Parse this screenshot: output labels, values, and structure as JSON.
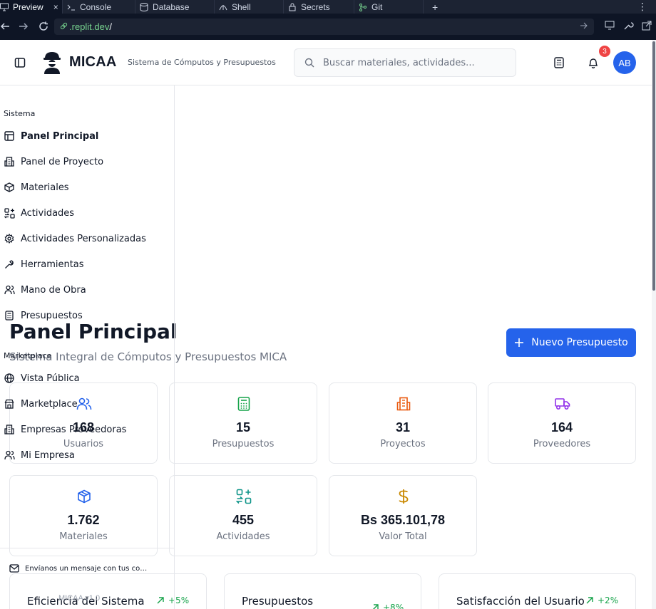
{
  "browser": {
    "tabs": [
      {
        "label": "Preview",
        "icon": "monitor-icon",
        "active": true
      },
      {
        "label": "Console",
        "icon": "terminal-icon"
      },
      {
        "label": "Database",
        "icon": "database-icon"
      },
      {
        "label": "Shell",
        "icon": "shell-icon"
      },
      {
        "label": "Secrets",
        "icon": "lock-icon"
      },
      {
        "label": "Git",
        "icon": "git-icon"
      }
    ],
    "close_glyph": "×",
    "plus_glyph": "+",
    "more_glyph": "⋮",
    "url_host": ".replit.dev",
    "url_path": "/"
  },
  "header": {
    "brand": "MICAA",
    "subtitle": "Sistema de Cómputos y Presupuestos",
    "search_placeholder": "Buscar materiales, actividades...",
    "notification_count": "3",
    "avatar_initials": "AB"
  },
  "sidebar": {
    "section_system": "Sistema",
    "items_system": [
      {
        "label": "Panel Principal",
        "icon": "layout-icon"
      },
      {
        "label": "Panel de Proyecto",
        "icon": "building-icon"
      },
      {
        "label": "Materiales",
        "icon": "package-icon"
      },
      {
        "label": "Actividades",
        "icon": "activity-grid-icon"
      },
      {
        "label": "Actividades Personalizadas",
        "icon": "settings-icon"
      },
      {
        "label": "Herramientas",
        "icon": "wrench-icon"
      },
      {
        "label": "Mano de Obra",
        "icon": "users-icon"
      },
      {
        "label": "Presupuestos",
        "icon": "calculator-icon"
      }
    ],
    "section_marketplace": "Marketplace",
    "items_marketplace": [
      {
        "label": "Vista Pública",
        "icon": "globe-icon"
      },
      {
        "label": "Marketplace",
        "icon": "store-icon"
      },
      {
        "label": "Empresas Proveedoras",
        "icon": "building-icon"
      },
      {
        "label": "Mi Empresa",
        "icon": "user-icon"
      }
    ],
    "footer_message": "Envíanos un mensaje con tus co…",
    "footer_version": "MICAA v1.0"
  },
  "main": {
    "title": "Panel Principal",
    "subtitle": "Sistema Integral de Cómputos y Presupuestos MICA",
    "new_button_label": "Nuevo Presupuesto",
    "stats": [
      {
        "value": "168",
        "label": "Usuarios",
        "icon": "users-icon",
        "color": "#2563eb"
      },
      {
        "value": "15",
        "label": "Presupuestos",
        "icon": "calculator-icon",
        "color": "#16a34a"
      },
      {
        "value": "31",
        "label": "Proyectos",
        "icon": "building-icon",
        "color": "#ea580c"
      },
      {
        "value": "164",
        "label": "Proveedores",
        "icon": "truck-icon",
        "color": "#9333ea"
      },
      {
        "value": "1.762",
        "label": "Materiales",
        "icon": "package-icon",
        "color": "#2563eb"
      },
      {
        "value": "455",
        "label": "Actividades",
        "icon": "activity-grid-icon",
        "color": "#0d9488"
      },
      {
        "value": "Bs 365.101,78",
        "label": "Valor Total",
        "icon": "dollar-icon",
        "color": "#ca8a04"
      }
    ],
    "bottom_cards": [
      {
        "title": "Eficiencia del Sistema",
        "trend": "+5%"
      },
      {
        "title": "Presupuestos",
        "trend": "+8%"
      },
      {
        "title": "Satisfacción del Usuario",
        "trend": "+2%"
      }
    ]
  }
}
